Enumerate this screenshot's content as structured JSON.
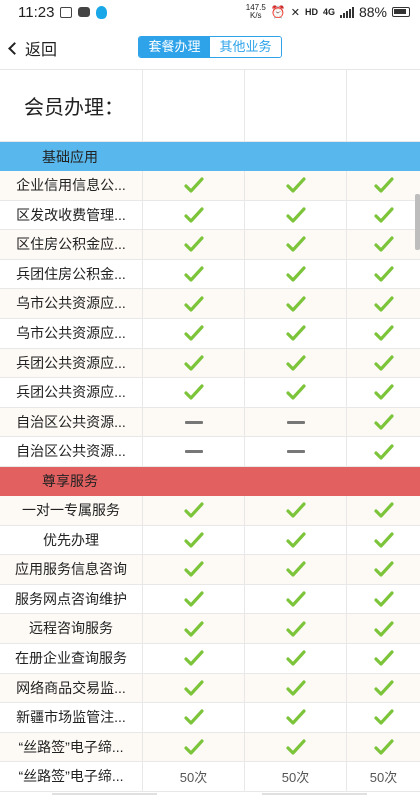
{
  "status_bar": {
    "time": "11:23",
    "speed_value": "147.5",
    "speed_unit": "K/s",
    "hd": "HD",
    "net": "4G",
    "battery": "88%"
  },
  "nav": {
    "back_label": "返回",
    "tabs": [
      "套餐办理",
      "其他业务"
    ],
    "active_tab": "套餐办理"
  },
  "table": {
    "title": "会员办理：",
    "sections": [
      {
        "name": "基础应用",
        "color": "#58b7ec",
        "rows": [
          {
            "name": "企业信用信息公...",
            "cells": [
              "check",
              "check",
              "check"
            ]
          },
          {
            "name": "区发改收费管理...",
            "cells": [
              "check",
              "check",
              "check"
            ]
          },
          {
            "name": "区住房公积金应...",
            "cells": [
              "check",
              "check",
              "check"
            ]
          },
          {
            "name": "兵团住房公积金...",
            "cells": [
              "check",
              "check",
              "check"
            ]
          },
          {
            "name": "乌市公共资源应...",
            "cells": [
              "check",
              "check",
              "check"
            ]
          },
          {
            "name": "乌市公共资源应...",
            "cells": [
              "check",
              "check",
              "check"
            ]
          },
          {
            "name": "兵团公共资源应...",
            "cells": [
              "check",
              "check",
              "check"
            ]
          },
          {
            "name": "兵团公共资源应...",
            "cells": [
              "check",
              "check",
              "check"
            ]
          },
          {
            "name": "自治区公共资源...",
            "cells": [
              "dash",
              "dash",
              "check"
            ]
          },
          {
            "name": "自治区公共资源...",
            "cells": [
              "dash",
              "dash",
              "check"
            ]
          }
        ]
      },
      {
        "name": "尊享服务",
        "color": "#e26060",
        "rows": [
          {
            "name": "一对一专属服务",
            "cells": [
              "check",
              "check",
              "check"
            ]
          },
          {
            "name": "优先办理",
            "cells": [
              "check",
              "check",
              "check"
            ]
          },
          {
            "name": "应用服务信息咨询",
            "cells": [
              "check",
              "check",
              "check"
            ]
          },
          {
            "name": "服务网点咨询维护",
            "cells": [
              "check",
              "check",
              "check"
            ]
          },
          {
            "name": "远程咨询服务",
            "cells": [
              "check",
              "check",
              "check"
            ]
          },
          {
            "name": "在册企业查询服务",
            "cells": [
              "check",
              "check",
              "check"
            ]
          },
          {
            "name": "网络商品交易监...",
            "cells": [
              "check",
              "check",
              "check"
            ]
          },
          {
            "name": "新疆市场监管注...",
            "cells": [
              "check",
              "check",
              "check"
            ]
          },
          {
            "name": "“丝路签”电子缔...",
            "cells": [
              "check",
              "check",
              "check"
            ]
          },
          {
            "name": "“丝路签”电子缔...",
            "cells": [
              "50次",
              "50次",
              "50次"
            ]
          }
        ]
      }
    ]
  },
  "colors": {
    "accent": "#2ea3ea",
    "check": "#7cc43a",
    "dash": "#777777"
  },
  "icons": {
    "check": "check-icon",
    "dash": "not-included-icon"
  }
}
